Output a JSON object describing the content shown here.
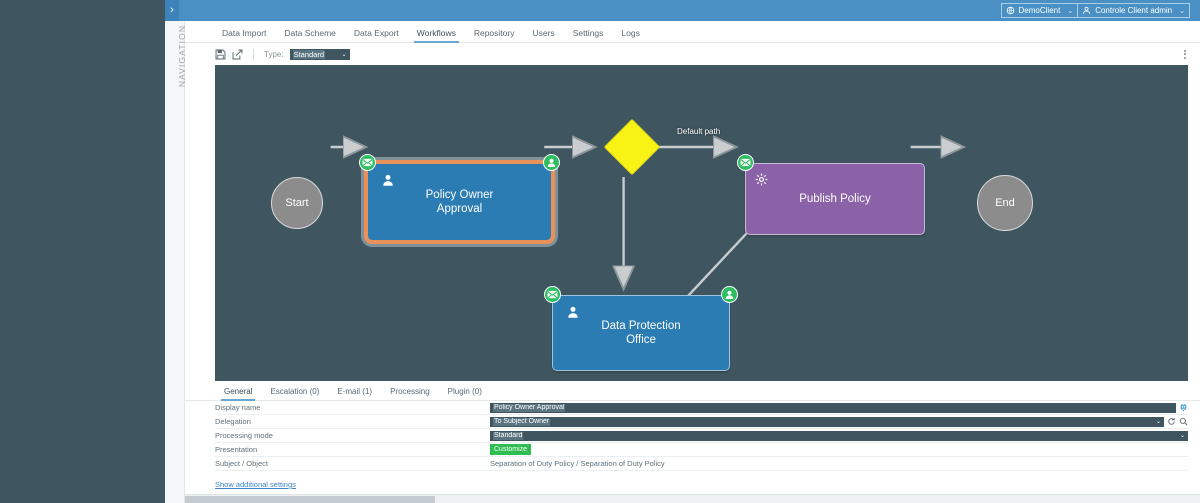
{
  "topbar": {
    "nav_toggle": "›",
    "client": "DemoClient",
    "user": "Controle Client admin",
    "caret": "⌄"
  },
  "navrail": {
    "label": "NAVIGATION"
  },
  "tabs": [
    {
      "label": "Data Import",
      "active": false
    },
    {
      "label": "Data Scheme",
      "active": false
    },
    {
      "label": "Data Export",
      "active": false
    },
    {
      "label": "Workflows",
      "active": true
    },
    {
      "label": "Repository",
      "active": false
    },
    {
      "label": "Users",
      "active": false
    },
    {
      "label": "Settings",
      "active": false
    },
    {
      "label": "Logs",
      "active": false
    }
  ],
  "toolbar": {
    "save_icon": "save-icon",
    "edit_icon": "edit-icon",
    "type_label": "Type:",
    "type_value": "Standard",
    "caret": "⌄",
    "menu_icon": "more-vertical-icon"
  },
  "diagram": {
    "nodes": [
      {
        "id": "start",
        "label": "Start",
        "shape": "circle",
        "color": "#8c8c8c"
      },
      {
        "id": "policy-owner-approval",
        "label": "Policy Owner\nApproval",
        "shape": "box",
        "color": "#2b7cb3",
        "selected": true
      },
      {
        "id": "decision",
        "label": "",
        "shape": "diamond",
        "color": "#f8f215"
      },
      {
        "id": "publish-policy",
        "label": "Publish Policy",
        "shape": "box",
        "color": "#8b62a8",
        "selected": false
      },
      {
        "id": "data-protection-office",
        "label": "Data Protection\nOffice",
        "shape": "box",
        "color": "#2b7cb3",
        "selected": false
      },
      {
        "id": "end",
        "label": "End",
        "shape": "circle",
        "color": "#8c8c8c"
      }
    ],
    "edge_labels": [
      {
        "text": "Default path"
      }
    ],
    "badge_colors": {
      "green": "#2dbe60",
      "selection": "#e8915a",
      "canvas": "#3f5661"
    }
  },
  "panel": {
    "tabs": [
      {
        "label": "General",
        "active": true
      },
      {
        "label": "Escalation (0)",
        "active": false
      },
      {
        "label": "E-mail (1)",
        "active": false
      },
      {
        "label": "Processing",
        "active": false
      },
      {
        "label": "Plugin (0)",
        "active": false
      }
    ],
    "rows": [
      {
        "label": "Display name",
        "value": "Policy Owner Approval",
        "kind": "text",
        "icons": [
          "globe-icon"
        ]
      },
      {
        "label": "Delegation",
        "value": "To Subject Owner",
        "kind": "select",
        "icons": [
          "refresh-icon",
          "search-icon"
        ]
      },
      {
        "label": "Processing mode",
        "value": "Standard",
        "kind": "select",
        "icons": []
      },
      {
        "label": "Presentation",
        "value": "Customize",
        "kind": "button",
        "icons": []
      },
      {
        "label": "Subject / Object",
        "value": "Separation of Duty Policy / Separation of Duty Policy",
        "kind": "plain",
        "icons": []
      }
    ],
    "additional_link": "Show additional settings"
  }
}
